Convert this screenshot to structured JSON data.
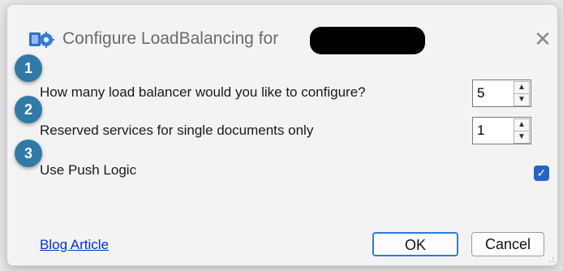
{
  "dialog": {
    "title": "Configure LoadBalancing for",
    "close_icon": "close-icon",
    "app_icon": "app-icon"
  },
  "rows": [
    {
      "badge": "1",
      "label": "How many load balancer would you like to configure?",
      "value": "5"
    },
    {
      "badge": "2",
      "label": "Reserved services for single documents only",
      "value": "1"
    },
    {
      "badge": "3",
      "label": "Use Push Logic",
      "checked": true
    }
  ],
  "footer": {
    "link": "Blog Article",
    "ok": "OK",
    "cancel": "Cancel"
  },
  "colors": {
    "badge": "#2f7ba7",
    "checkbox": "#2563c9",
    "link": "#0033cc",
    "ok_border": "#2f7ad8"
  }
}
